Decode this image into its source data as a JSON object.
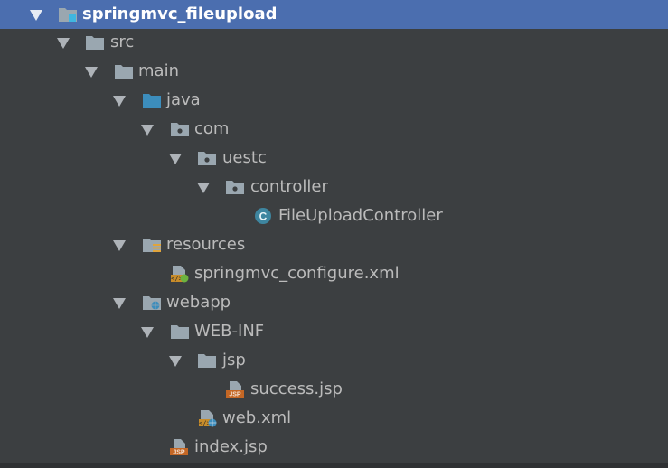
{
  "colors": {
    "background": "#3c3f41",
    "selection": "#4b6eaf",
    "text": "#bbbbbb",
    "folder": "#9aa7b0",
    "source_folder": "#3c8dbc",
    "class_icon": "#3e86a0",
    "jsp_icon": "#c46725"
  },
  "tree": [
    {
      "label": "springmvc_fileupload",
      "icon": "module-folder-icon",
      "expanded": true,
      "selected": true
    },
    {
      "label": "src",
      "icon": "folder-icon",
      "expanded": true
    },
    {
      "label": "main",
      "icon": "folder-icon",
      "expanded": true
    },
    {
      "label": "java",
      "icon": "source-folder-icon",
      "expanded": true
    },
    {
      "label": "com",
      "icon": "package-icon",
      "expanded": true
    },
    {
      "label": "uestc",
      "icon": "package-icon",
      "expanded": true
    },
    {
      "label": "controller",
      "icon": "package-icon",
      "expanded": true
    },
    {
      "label": "FileUploadController",
      "icon": "java-class-icon"
    },
    {
      "label": "resources",
      "icon": "resources-folder-icon",
      "expanded": true
    },
    {
      "label": "springmvc_configure.xml",
      "icon": "spring-xml-icon"
    },
    {
      "label": "webapp",
      "icon": "web-folder-icon",
      "expanded": true
    },
    {
      "label": "WEB-INF",
      "icon": "folder-icon",
      "expanded": true
    },
    {
      "label": "jsp",
      "icon": "folder-icon",
      "expanded": true
    },
    {
      "label": "success.jsp",
      "icon": "jsp-file-icon"
    },
    {
      "label": "web.xml",
      "icon": "web-xml-icon"
    },
    {
      "label": "index.jsp",
      "icon": "jsp-file-icon"
    }
  ]
}
